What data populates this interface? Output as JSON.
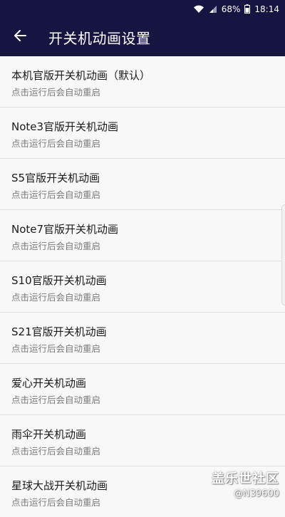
{
  "status_bar": {
    "battery": "68%",
    "time": "18:14",
    "icons": [
      "wifi-icon",
      "signal-icon",
      "battery-icon"
    ]
  },
  "header": {
    "title": "开关机动画设置",
    "back_icon": "arrow-left-icon"
  },
  "items": [
    {
      "title": "本机官版开关机动画（默认）",
      "subtitle": "点击运行后会自动重启"
    },
    {
      "title": "Note3官版开关机动画",
      "subtitle": "点击运行后会自动重启"
    },
    {
      "title": "S5官版开关机动画",
      "subtitle": "点击运行后会自动重启"
    },
    {
      "title": "Note7官版开关机动画",
      "subtitle": "点击运行后会自动重启"
    },
    {
      "title": "S10官版开关机动画",
      "subtitle": "点击运行后会自动重启"
    },
    {
      "title": "S21官版开关机动画",
      "subtitle": "点击运行后会自动重启"
    },
    {
      "title": "爱心开关机动画",
      "subtitle": "点击运行后会自动重启"
    },
    {
      "title": "雨伞开关机动画",
      "subtitle": "点击运行后会自动重启"
    },
    {
      "title": "星球大战开关机动画",
      "subtitle": "点击运行后会自动重启"
    }
  ],
  "watermark": {
    "logo": "盖乐世社区",
    "user": "@N39600"
  },
  "colors": {
    "header_bg": "#161440",
    "list_bg": "#f8f8f8",
    "divider": "#dcdcdc",
    "title_text": "#1a1a1a",
    "subtitle_text": "#7a7a7a"
  }
}
